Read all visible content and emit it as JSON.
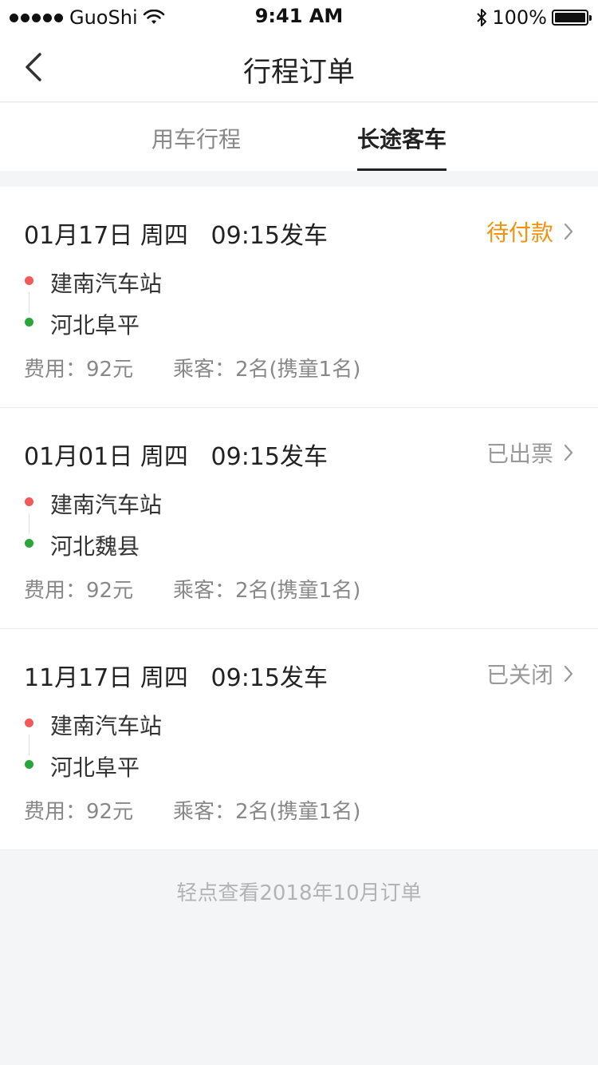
{
  "status_bar": {
    "carrier": "GuoShi",
    "time": "9:41 AM",
    "battery": "100%"
  },
  "nav": {
    "title": "行程订单",
    "back_icon": "chevron-left-icon"
  },
  "tabs": [
    {
      "label": "用车行程",
      "active": false
    },
    {
      "label": "长途客车",
      "active": true
    }
  ],
  "orders": [
    {
      "date": "01月17日",
      "weekday": "周四",
      "depart": "09:15发车",
      "status": "待付款",
      "status_type": "pending",
      "from": "建南汽车站",
      "to": "河北阜平",
      "fee": "费用：92元",
      "passengers": "乘客：2名(携童1名)"
    },
    {
      "date": "01月01日",
      "weekday": "周四",
      "depart": "09:15发车",
      "status": "已出票",
      "status_type": "issued",
      "from": "建南汽车站",
      "to": "河北魏县",
      "fee": "费用：92元",
      "passengers": "乘客：2名(携童1名)"
    },
    {
      "date": "11月17日",
      "weekday": "周四",
      "depart": "09:15发车",
      "status": "已关闭",
      "status_type": "closed",
      "from": "建南汽车站",
      "to": "河北阜平",
      "fee": "费用：92元",
      "passengers": "乘客：2名(携童1名)"
    }
  ],
  "footer_link": "轻点查看2018年10月订单",
  "colors": {
    "pending": "#f5910c",
    "origin_dot": "#f25a5a",
    "destination_dot": "#2aa53a"
  }
}
